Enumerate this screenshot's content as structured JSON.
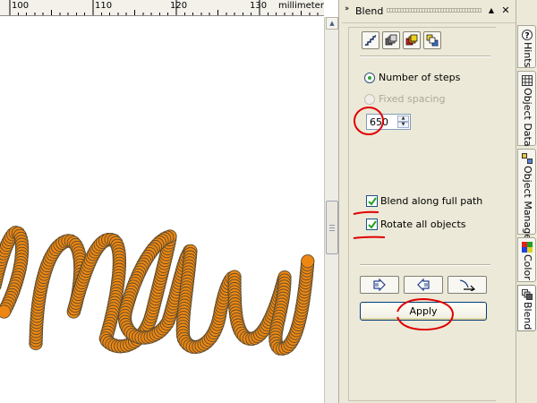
{
  "ruler": {
    "unit": "millimeters",
    "labels": [
      "100",
      "110",
      "120",
      "130"
    ]
  },
  "docker": {
    "title": "Blend",
    "mode_buttons": [
      "steps-icon",
      "acceleration-icon",
      "color-blend-icon",
      "misc-blend-icon"
    ],
    "options": {
      "number_of_steps": {
        "label": "Number of steps",
        "selected": true
      },
      "fixed_spacing": {
        "label": "Fixed spacing",
        "selected": false,
        "enabled": false
      },
      "steps_value": "650"
    },
    "checkboxes": {
      "blend_full_path": {
        "label": "Blend along full path",
        "checked": true
      },
      "rotate_all": {
        "label": "Rotate all objects",
        "checked": true
      }
    },
    "nav_buttons": [
      "start-object-icon",
      "end-object-icon",
      "path-properties-icon"
    ],
    "apply_label": "Apply"
  },
  "tabs": [
    {
      "label": "Hints",
      "icon": "question-icon"
    },
    {
      "label": "Object Data",
      "icon": "table-icon"
    },
    {
      "label": "Object Manager",
      "icon": "layers-icon"
    },
    {
      "label": "Color",
      "icon": "color-grid-icon"
    },
    {
      "label": "Blend",
      "icon": "blend-icon",
      "active": true
    }
  ],
  "colors": {
    "blend_orange": "#ed8712",
    "blend_outline": "#5a4a2e",
    "annotation_red": "#e00000",
    "docker_bg": "#ece9d8"
  }
}
